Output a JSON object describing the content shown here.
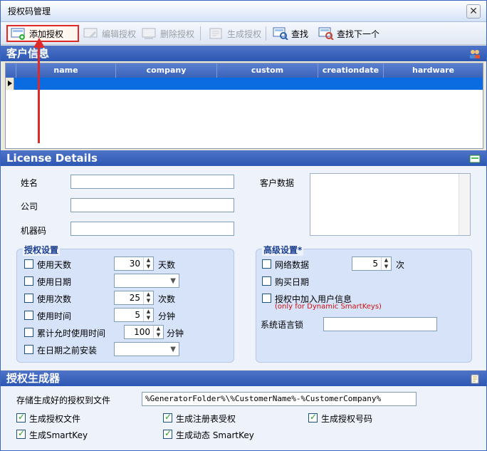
{
  "window": {
    "title": "授权码管理",
    "close_glyph": "✕"
  },
  "toolbar": {
    "add": "添加授权",
    "edit": "编辑授权",
    "delete": "删除授权",
    "generate": "生成授权",
    "find": "查找",
    "find_next": "查找下一个"
  },
  "customers": {
    "title": "客户信息",
    "columns": [
      "name",
      "company",
      "custom",
      "creationdate",
      "hardware"
    ]
  },
  "license": {
    "title": "License Details",
    "name_label": "姓名",
    "company_label": "公司",
    "machine_label": "机器码",
    "customer_data_label": "客户数据",
    "name_value": "",
    "company_value": "",
    "machine_value": ""
  },
  "auth_settings": {
    "title": "授权设置",
    "use_days": "使用天数",
    "days_value": "30",
    "days_unit": "天数",
    "use_date": "使用日期",
    "use_count": "使用次数",
    "count_value": "25",
    "count_unit": "次数",
    "use_time": "使用时间",
    "time_value": "5",
    "time_unit": "分钟",
    "cumulative": "累计允时使用时间",
    "cumulative_value": "100",
    "cumulative_unit": "分钟",
    "install_before": "在日期之前安装"
  },
  "advanced": {
    "title": "高级设置*",
    "network": "网络数据",
    "network_value": "5",
    "network_unit": "次",
    "purchase_date": "购买日期",
    "add_user_info": "授权中加入用户信息",
    "note": "(only for Dynamic SmartKeys)",
    "language": "系统语言锁"
  },
  "generator": {
    "title": "授权生成器",
    "save_label": "存储生成好的授权到文件",
    "save_path": "%GeneratorFolder%\\%CustomerName%-%CustomerCompany%",
    "gen_license_file": "生成授权文件",
    "gen_registry": "生成注册表受权",
    "gen_license_code": "生成授权号码",
    "gen_smartkey": "生成SmartKey",
    "gen_dynamic_smartkey": "生成动态 SmartKey"
  }
}
